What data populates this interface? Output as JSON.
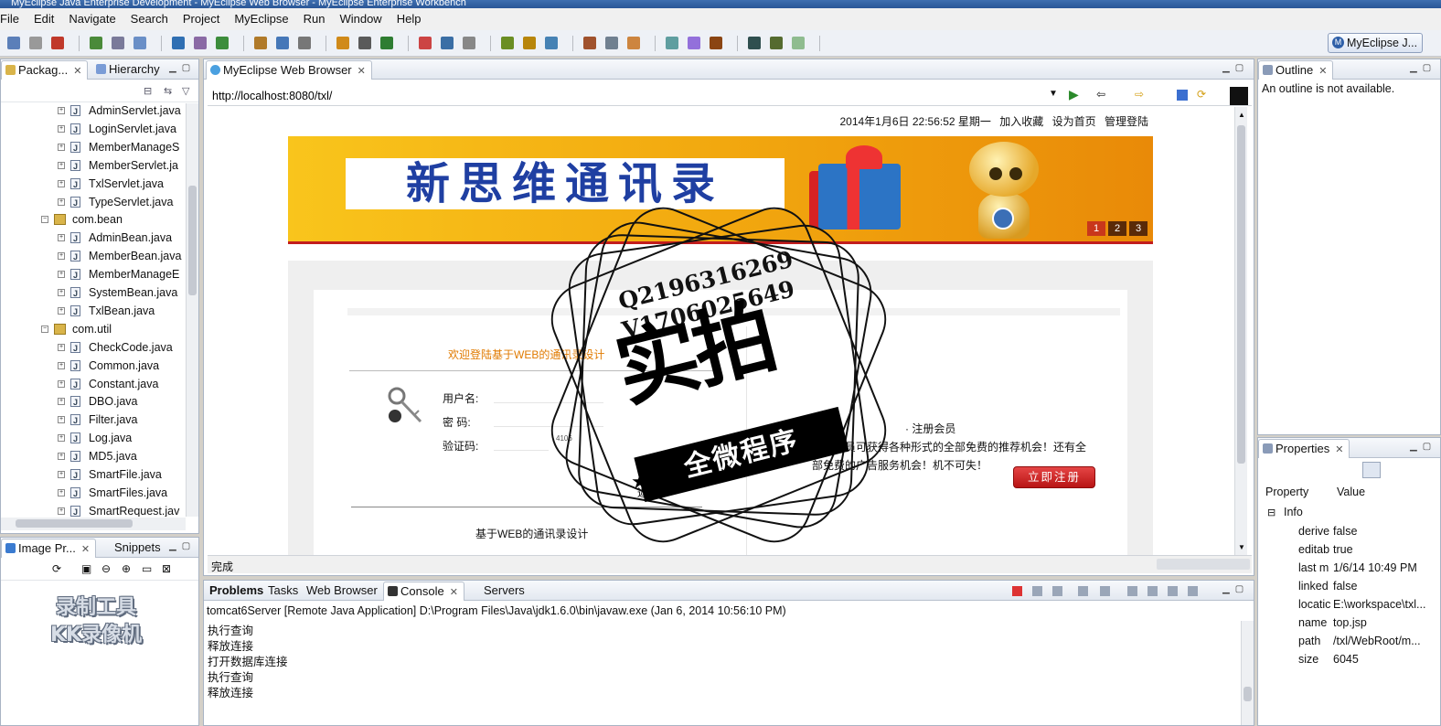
{
  "window": {
    "title": "MyEclipse Java Enterprise Development - MyEclipse Web Browser - MyEclipse Enterprise Workbench"
  },
  "menu": [
    "File",
    "Edit",
    "Navigate",
    "Search",
    "Project",
    "MyEclipse",
    "Run",
    "Window",
    "Help"
  ],
  "perspective": {
    "label": "MyEclipse J..."
  },
  "package_explorer": {
    "tabs": [
      "Packag...",
      "Hierarchy"
    ],
    "items": [
      {
        "label": "AdminServlet.java",
        "kind": "file",
        "depth": 2
      },
      {
        "label": "LoginServlet.java",
        "kind": "file",
        "depth": 2
      },
      {
        "label": "MemberManageS",
        "kind": "file",
        "depth": 2
      },
      {
        "label": "MemberServlet.ja",
        "kind": "file",
        "depth": 2
      },
      {
        "label": "TxlServlet.java",
        "kind": "file",
        "depth": 2
      },
      {
        "label": "TypeServlet.java",
        "kind": "file",
        "depth": 2
      },
      {
        "label": "com.bean",
        "kind": "package",
        "depth": 1
      },
      {
        "label": "AdminBean.java",
        "kind": "file",
        "depth": 2
      },
      {
        "label": "MemberBean.java",
        "kind": "file",
        "depth": 2
      },
      {
        "label": "MemberManageE",
        "kind": "file",
        "depth": 2
      },
      {
        "label": "SystemBean.java",
        "kind": "file",
        "depth": 2
      },
      {
        "label": "TxlBean.java",
        "kind": "file",
        "depth": 2
      },
      {
        "label": "com.util",
        "kind": "package",
        "depth": 1
      },
      {
        "label": "CheckCode.java",
        "kind": "file",
        "depth": 2
      },
      {
        "label": "Common.java",
        "kind": "file",
        "depth": 2
      },
      {
        "label": "Constant.java",
        "kind": "file",
        "depth": 2
      },
      {
        "label": "DBO.java",
        "kind": "file",
        "depth": 2
      },
      {
        "label": "Filter.java",
        "kind": "file",
        "depth": 2
      },
      {
        "label": "Log.java",
        "kind": "file",
        "depth": 2
      },
      {
        "label": "MD5.java",
        "kind": "file",
        "depth": 2
      },
      {
        "label": "SmartFile.java",
        "kind": "file",
        "depth": 2
      },
      {
        "label": "SmartFiles.java",
        "kind": "file",
        "depth": 2
      },
      {
        "label": "SmartRequest.jav",
        "kind": "file",
        "depth": 2
      }
    ]
  },
  "image_panel": {
    "tabs": [
      "Image Pr...",
      "Snippets"
    ]
  },
  "watermark": {
    "line1": "录制工具",
    "line2": "KK录像机"
  },
  "browser": {
    "tab": "MyEclipse Web Browser",
    "url": "http://localhost:8080/txl/",
    "status": "完成",
    "page": {
      "datetime": "2014年1月6日  22:56:52   星期一",
      "links": [
        "加入收藏",
        "设为首页",
        "管理登陆"
      ],
      "banner_title": "新思维通讯录",
      "banner_pages": [
        "1",
        "2",
        "3"
      ],
      "welcome": "欢迎登陆基于WEB的通讯录设计",
      "username_label": "用户名:",
      "password_label": "密   码:",
      "captcha_label": "验证码:",
      "captcha_value": "4106",
      "back_label": "返回",
      "footer": "基于WEB的通讯录设计",
      "register_title": "· 注册会员",
      "register_desc": "注册会员可获得各种形式的全部免费的推荐机会！还有全部免费的广告服务机会！机不可失！",
      "register_button": "立即注册"
    }
  },
  "outline": {
    "tab": "Outline",
    "message": "An outline is not available."
  },
  "properties": {
    "tab": "Properties",
    "header_property": "Property",
    "header_value": "Value",
    "group": "Info",
    "rows": [
      {
        "key": "derive",
        "value": "false"
      },
      {
        "key": "editab",
        "value": "true"
      },
      {
        "key": "last m",
        "value": "1/6/14 10:49 PM"
      },
      {
        "key": "linked",
        "value": "false"
      },
      {
        "key": "locatic",
        "value": "E:\\workspace\\txl..."
      },
      {
        "key": "name",
        "value": "top.jsp"
      },
      {
        "key": "path",
        "value": "/txl/WebRoot/m..."
      },
      {
        "key": "size",
        "value": "6045"
      }
    ]
  },
  "console": {
    "tabs": [
      "Problems",
      "Tasks",
      "Web Browser",
      "Console",
      "Servers"
    ],
    "header": "tomcat6Server [Remote Java Application] D:\\Program Files\\Java\\jdk1.6.0\\bin\\javaw.exe (Jan 6, 2014 10:56:10 PM)",
    "lines": [
      "执行查询",
      "释放连接",
      "打开数据库连接",
      "执行查询",
      "释放连接"
    ]
  },
  "stamp": {
    "qq": "Q2196316269",
    "wechat": "V1706025649",
    "big": "实拍",
    "ribbon": "全微程序"
  },
  "colors": {
    "accent": "#2e5fa8",
    "banner_title": "#1f3fa2",
    "welcome": "#e07a00",
    "register_button": "#c41e1e"
  }
}
